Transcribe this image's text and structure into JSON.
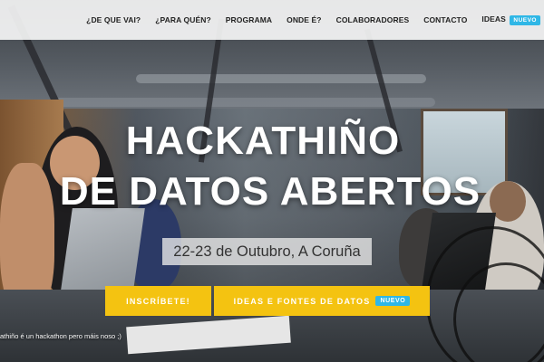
{
  "nav": {
    "items": [
      {
        "label": "¿DE QUE VAI?"
      },
      {
        "label": "¿PARA QUÉN?"
      },
      {
        "label": "PROGRAMA"
      },
      {
        "label": "ONDE É?"
      },
      {
        "label": "COLABORADORES"
      },
      {
        "label": "CONTACTO"
      },
      {
        "label": "IDEAS",
        "badge": "NUEVO"
      }
    ]
  },
  "hero": {
    "title_line1": "HACKATHIÑO",
    "title_line2": "DE DATOS ABERTOS",
    "date": "22-23 de Outubro, A Coruña",
    "buttons": {
      "register": "INSCRÍBETE!",
      "ideas": "IDEAS E FONTES DE DATOS",
      "ideas_badge": "NUEVO"
    }
  },
  "photo_caption": "athiño é un hackathon pero máis noso ;)",
  "colors": {
    "accent_yellow": "#f4c311",
    "badge_blue": "#2fb7e6",
    "nav_text": "#222222"
  }
}
